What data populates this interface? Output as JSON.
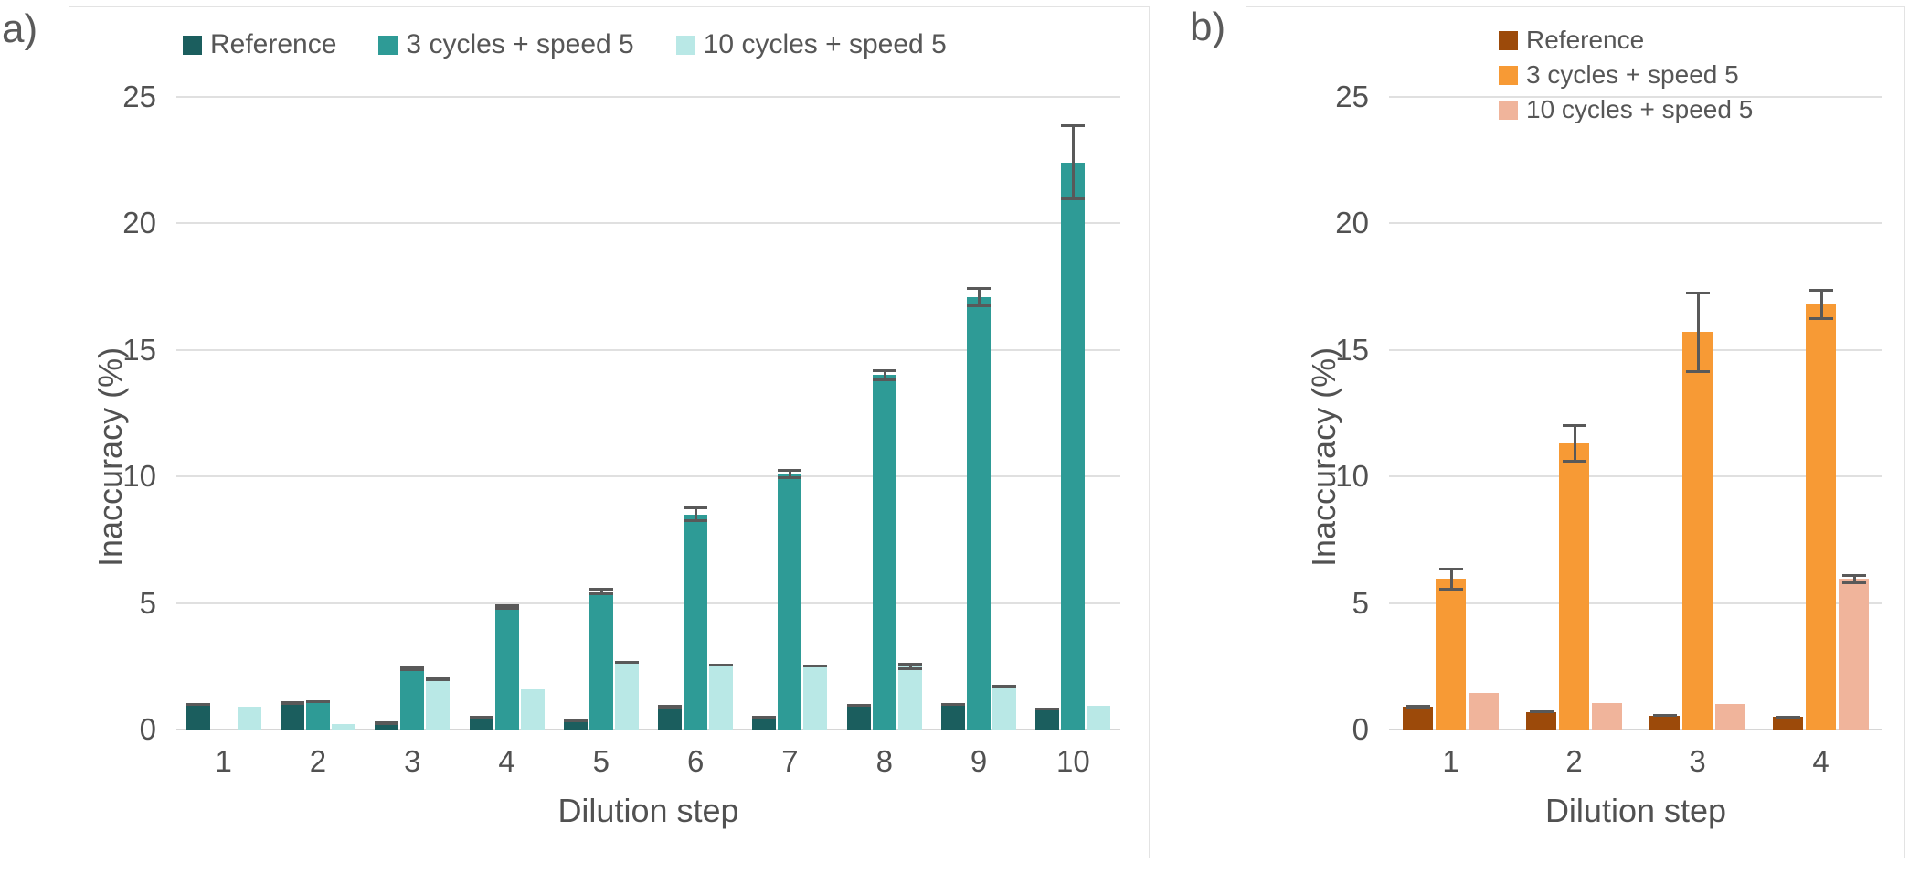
{
  "panels": {
    "a": {
      "tag": "a)"
    },
    "b": {
      "tag": "b)"
    }
  },
  "axis": {
    "ylabel": "Inaccuracy (%)",
    "xlabel": "Dilution step",
    "yticks": [
      "0",
      "5",
      "10",
      "15",
      "20",
      "25"
    ]
  },
  "colors": {
    "a_reference": "#1b5e5e",
    "a_3cycles": "#2e9b96",
    "a_10cycles": "#b9e8e6",
    "b_reference": "#9c4a0a",
    "b_3cycles": "#f79a35",
    "b_10cycles": "#f0b49b",
    "gridline": "#e0e0e0",
    "text": "#515151",
    "error": "#595959",
    "panel_border": "#e3e3e3"
  },
  "legend_a": [
    {
      "label": "Reference",
      "color": "#1b5e5e"
    },
    {
      "label": "3 cycles + speed 5",
      "color": "#2e9b96"
    },
    {
      "label": "10 cycles + speed 5",
      "color": "#b9e8e6"
    }
  ],
  "legend_b": [
    {
      "label": "Reference",
      "color": "#9c4a0a"
    },
    {
      "label": "3 cycles + speed 5",
      "color": "#f79a35"
    },
    {
      "label": "10 cycles + speed 5",
      "color": "#f0b49b"
    }
  ],
  "chart_data": [
    {
      "id": "panel-a",
      "type": "bar",
      "title": "a)",
      "xlabel": "Dilution step",
      "ylabel": "Inaccuracy (%)",
      "ylim": [
        0,
        25
      ],
      "ytick_values": [
        0,
        5,
        10,
        15,
        20,
        25
      ],
      "grid": true,
      "legend_position": "top",
      "categories": [
        "1",
        "2",
        "3",
        "4",
        "5",
        "6",
        "7",
        "8",
        "9",
        "10"
      ],
      "series": [
        {
          "name": "Reference",
          "color": "#1b5e5e",
          "values": [
            1.0,
            1.05,
            0.25,
            0.5,
            0.35,
            0.9,
            0.5,
            0.95,
            1.0,
            0.8
          ],
          "errors": [
            0.05,
            0.05,
            0.05,
            0.05,
            0.05,
            0.05,
            0.05,
            0.05,
            0.05,
            0.05
          ]
        },
        {
          "name": "3 cycles + speed 5",
          "color": "#2e9b96",
          "values": [
            0.0,
            1.1,
            2.4,
            4.85,
            5.45,
            8.5,
            10.1,
            14.0,
            17.1,
            22.4
          ],
          "errors": [
            0.0,
            0.05,
            0.1,
            0.1,
            0.15,
            0.3,
            0.2,
            0.25,
            0.4,
            1.5
          ]
        },
        {
          "name": "10 cycles + speed 5",
          "color": "#b9e8e6",
          "values": [
            0.9,
            0.2,
            2.0,
            1.6,
            2.65,
            2.55,
            2.5,
            2.5,
            1.7,
            0.95
          ],
          "errors": [
            0.0,
            0.0,
            0.1,
            0.0,
            0.05,
            0.05,
            0.05,
            0.15,
            0.05,
            0.0
          ]
        }
      ]
    },
    {
      "id": "panel-b",
      "type": "bar",
      "title": "b)",
      "xlabel": "Dilution step",
      "ylabel": "Inaccuracy (%)",
      "ylim": [
        0,
        25
      ],
      "ytick_values": [
        0,
        5,
        10,
        15,
        20,
        25
      ],
      "grid": true,
      "legend_position": "top",
      "categories": [
        "1",
        "2",
        "3",
        "4"
      ],
      "series": [
        {
          "name": "Reference",
          "color": "#9c4a0a",
          "values": [
            0.9,
            0.7,
            0.55,
            0.5
          ],
          "errors": [
            0.05,
            0.05,
            0.05,
            0.05
          ]
        },
        {
          "name": "3 cycles + speed 5",
          "color": "#f79a35",
          "values": [
            5.95,
            11.3,
            15.7,
            16.8
          ],
          "errors": [
            0.45,
            0.75,
            1.6,
            0.6
          ]
        },
        {
          "name": "10 cycles + speed 5",
          "color": "#f0b49b",
          "values": [
            1.45,
            1.05,
            1.0,
            5.95
          ],
          "errors": [
            0.0,
            0.0,
            0.0,
            0.2
          ]
        }
      ]
    }
  ]
}
